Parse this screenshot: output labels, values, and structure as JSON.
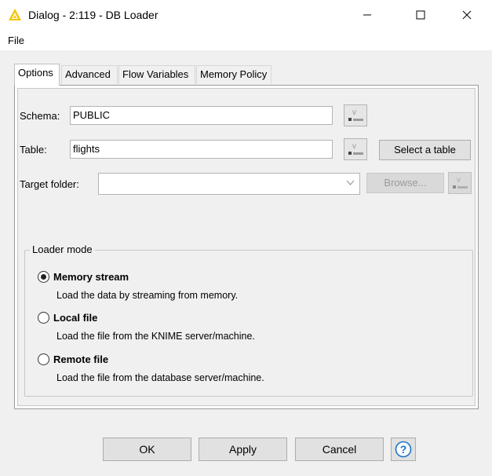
{
  "window": {
    "title": "Dialog - 2:119 - DB Loader",
    "icon": "knime-warning-triangle-icon",
    "controls": [
      "minimize-icon",
      "maximize-icon",
      "close-icon"
    ]
  },
  "menu": {
    "items": [
      {
        "label": "File"
      }
    ]
  },
  "tabs": [
    {
      "label": "Options",
      "active": true
    },
    {
      "label": "Advanced",
      "active": false
    },
    {
      "label": "Flow Variables",
      "active": false
    },
    {
      "label": "Memory Policy",
      "active": false
    }
  ],
  "options": {
    "schema": {
      "label": "Schema:",
      "value": "PUBLIC"
    },
    "table": {
      "label": "Table:",
      "value": "flights",
      "select_button": "Select a table"
    },
    "target_folder": {
      "label": "Target folder:",
      "value": "",
      "browse_button": "Browse...",
      "browse_enabled": false
    }
  },
  "loader_mode": {
    "title": "Loader mode",
    "selected": "Memory stream",
    "options": [
      {
        "label": "Memory stream",
        "description": "Load the data by streaming from memory.",
        "checked": true
      },
      {
        "label": "Local file",
        "description": "Load the file from the KNIME server/machine.",
        "checked": false
      },
      {
        "label": "Remote file",
        "description": "Load the file from the database server/machine.",
        "checked": false
      }
    ]
  },
  "footer": {
    "ok": "OK",
    "apply": "Apply",
    "cancel": "Cancel",
    "help_icon": "question-mark-help-icon"
  },
  "colors": {
    "knime_yellow": "#f5c400",
    "help_blue": "#1e73c8",
    "dialog_bg": "#f0f0f0"
  }
}
